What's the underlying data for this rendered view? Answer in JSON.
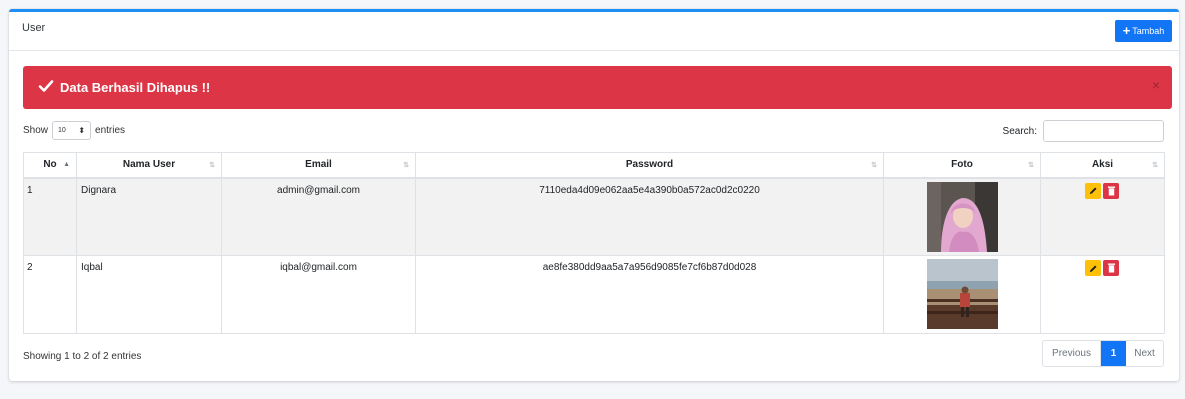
{
  "card": {
    "title": "User",
    "add_label": "Tambah"
  },
  "alert": {
    "message": "Data Berhasil Dihapus !!",
    "close": "×"
  },
  "length": {
    "show": "Show",
    "value": "10",
    "entries": "entries"
  },
  "search": {
    "label": "Search:"
  },
  "table": {
    "headers": [
      "No",
      "Nama User",
      "Email",
      "Password",
      "Foto",
      "Aksi"
    ],
    "rows": [
      {
        "no": "1",
        "name": "Dignara",
        "email": "admin@gmail.com",
        "password": "7110eda4d09e062aa5e4a390b0a572ac0d2c0220"
      },
      {
        "no": "2",
        "name": "Iqbal",
        "email": "iqbal@gmail.com",
        "password": "ae8fe380dd9aa5a7a956d9085fe7cf6b87d0d028"
      }
    ]
  },
  "footer": {
    "info": "Showing 1 to 2 of 2 entries"
  },
  "pagination": {
    "previous": "Previous",
    "page": "1",
    "next": "Next"
  },
  "colors": {
    "primary": "#1175f5",
    "danger": "#dc3545",
    "warning": "#ffc107"
  }
}
